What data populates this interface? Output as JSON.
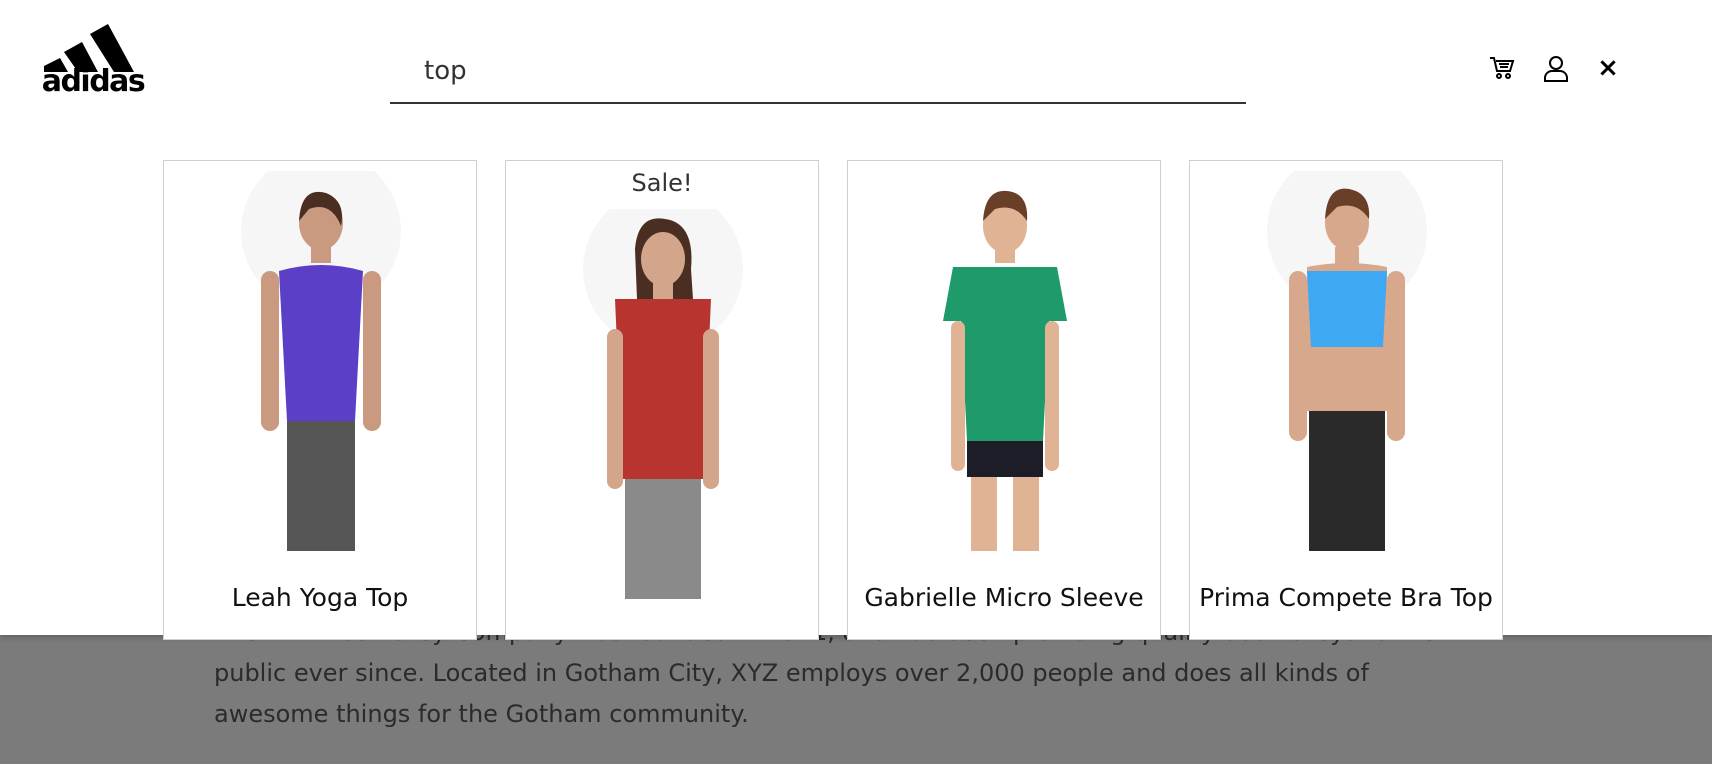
{
  "brand": {
    "name": "adidas"
  },
  "search": {
    "value": "top",
    "placeholder": ""
  },
  "header": {
    "cart_icon": "cart-icon",
    "user_icon": "user-icon",
    "close_label": "×"
  },
  "results": [
    {
      "name": "Leah Yoga Top",
      "sale": "",
      "top_color": "#5b3fc7",
      "bottom_color": "#555"
    },
    {
      "name": "",
      "sale": "Sale!",
      "top_color": "#b7342f",
      "bottom_color": "#8a8a8a"
    },
    {
      "name": "Gabrielle Micro Sleeve",
      "sale": "",
      "top_color": "#1f9a6b",
      "bottom_color": "#1d1d28"
    },
    {
      "name": "Prima Compete Bra Top",
      "sale": "",
      "top_color": "#3ea9f2",
      "bottom_color": "#2a2a2a"
    }
  ],
  "background_text": {
    "line1": "The XYZ Doohickey Company was founded in 1971, and has been providing quality doohickeys to the",
    "line2": "public ever since. Located in Gotham City, XYZ employs over 2,000 people and does all kinds of",
    "line3": "awesome things for the Gotham community."
  }
}
